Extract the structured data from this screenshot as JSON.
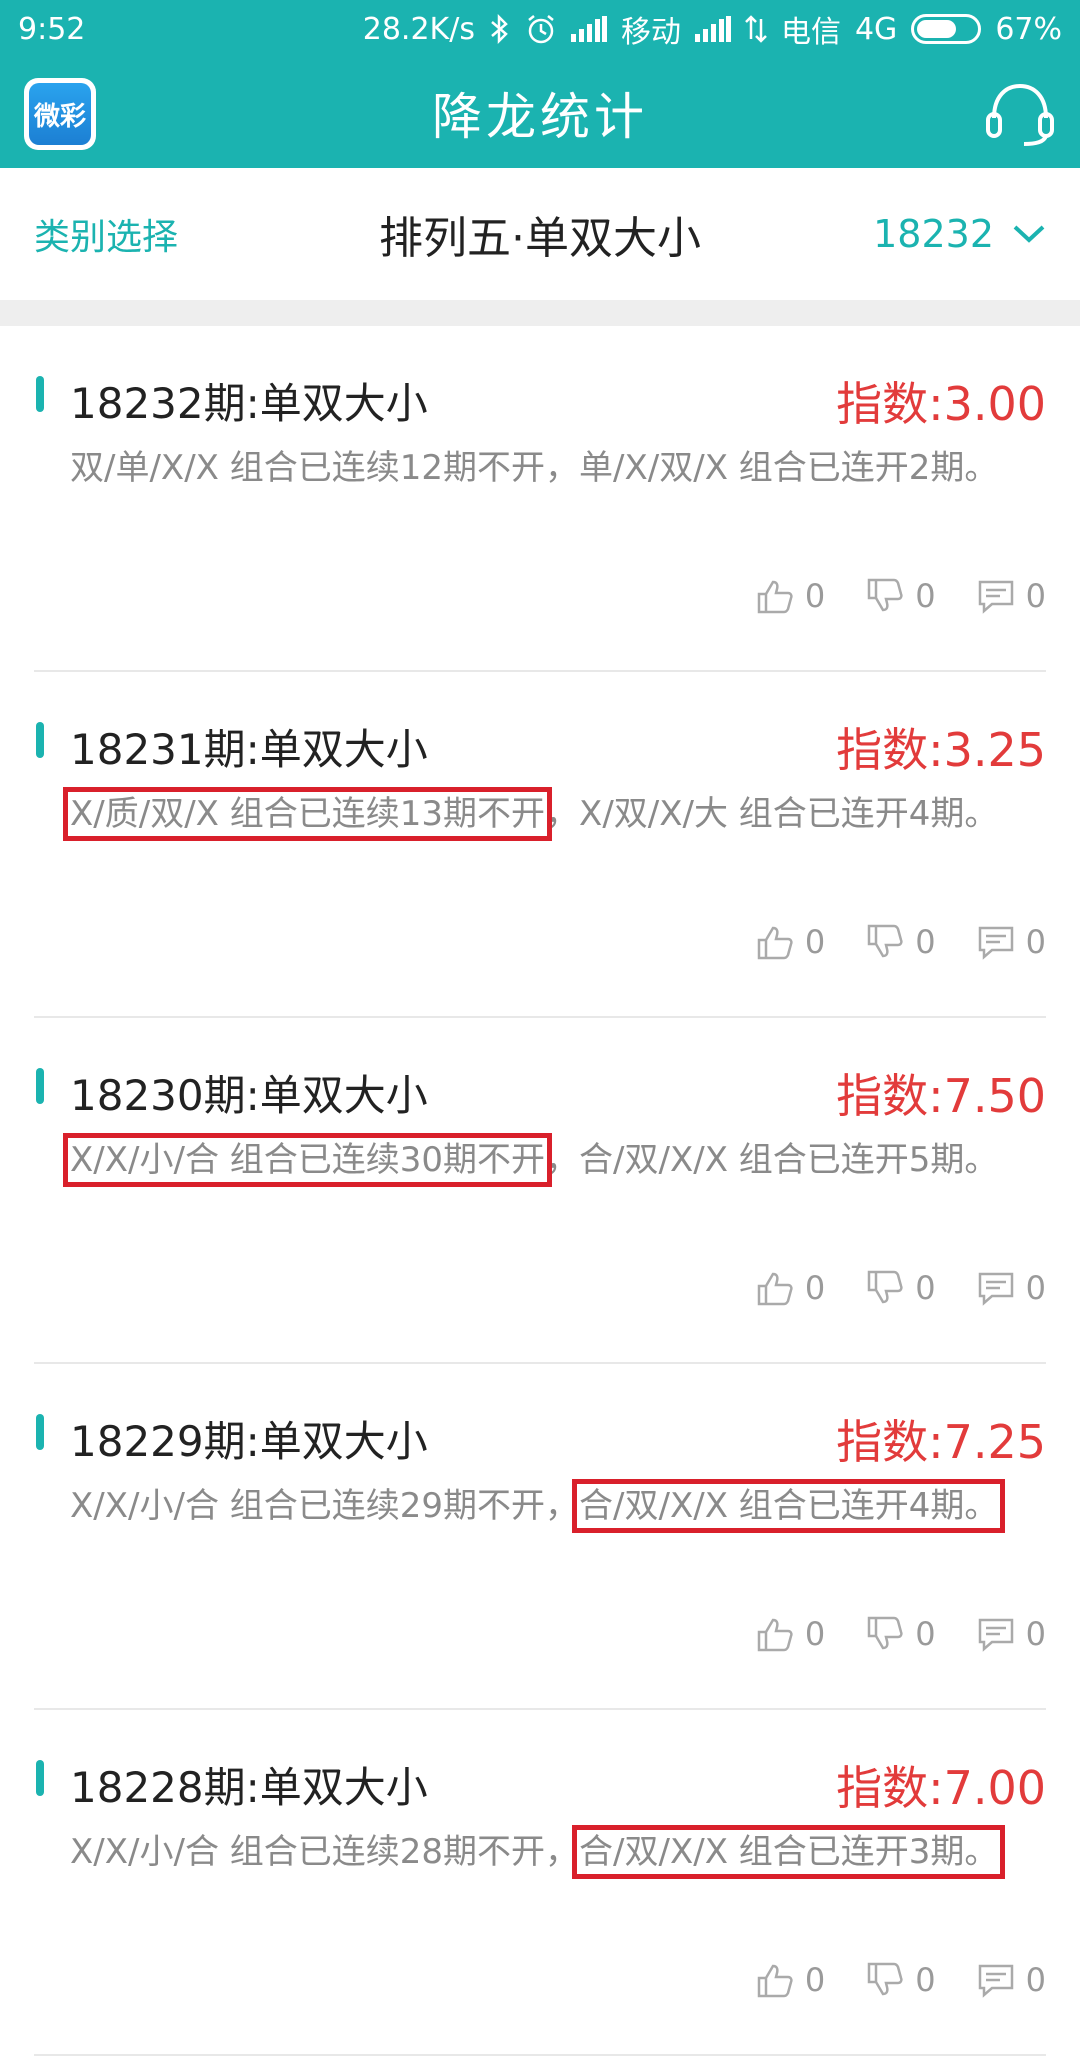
{
  "status_bar": {
    "time": "9:52",
    "speed": "28.2K/s",
    "carrier1": "移动",
    "carrier2": "电信",
    "network": "4G",
    "battery_percent": "67%",
    "battery_level": 0.67,
    "icons": [
      "bluetooth-icon",
      "alarm-icon",
      "signal-icon",
      "signal-icon",
      "data-icon"
    ]
  },
  "app_bar": {
    "logo_text": "微彩",
    "title": "降龙统计",
    "right_icon": "headset-icon"
  },
  "filter_bar": {
    "category_label": "类别选择",
    "title": "排列五·单双大小",
    "period_value": "18232",
    "dropdown_icon": "chevron-down-icon"
  },
  "colors": {
    "accent": "#1bb3b0",
    "index_red": "#e23b3b",
    "highlight_red": "#d9202b",
    "desc_gray": "#8a8a8a"
  },
  "items": [
    {
      "title": "18232期:单双大小",
      "index": "指数:3.00",
      "desc_a": "双/单/X/X 组合已连续12期不开",
      "desc_sep": "，",
      "desc_b": "单/X/双/X 组合已连开2期。",
      "highlight": "none",
      "likes": "0",
      "dislikes": "0",
      "comments": "0"
    },
    {
      "title": "18231期:单双大小",
      "index": "指数:3.25",
      "desc_a": "X/质/双/X 组合已连续13期不开",
      "desc_sep": "，",
      "desc_b": "X/双/X/大 组合已连开4期。",
      "highlight": "a",
      "likes": "0",
      "dislikes": "0",
      "comments": "0"
    },
    {
      "title": "18230期:单双大小",
      "index": "指数:7.50",
      "desc_a": "X/X/小/合 组合已连续30期不开",
      "desc_sep": "，",
      "desc_b": "合/双/X/X 组合已连开5期。",
      "highlight": "a",
      "likes": "0",
      "dislikes": "0",
      "comments": "0"
    },
    {
      "title": "18229期:单双大小",
      "index": "指数:7.25",
      "desc_a": "X/X/小/合 组合已连续29期不开",
      "desc_sep": "，",
      "desc_b": "合/双/X/X 组合已连开4期。",
      "highlight": "b",
      "likes": "0",
      "dislikes": "0",
      "comments": "0"
    },
    {
      "title": "18228期:单双大小",
      "index": "指数:7.00",
      "desc_a": "X/X/小/合 组合已连续28期不开",
      "desc_sep": "，",
      "desc_b": "合/双/X/X 组合已连开3期。",
      "highlight": "b",
      "likes": "0",
      "dislikes": "0",
      "comments": "0"
    }
  ]
}
